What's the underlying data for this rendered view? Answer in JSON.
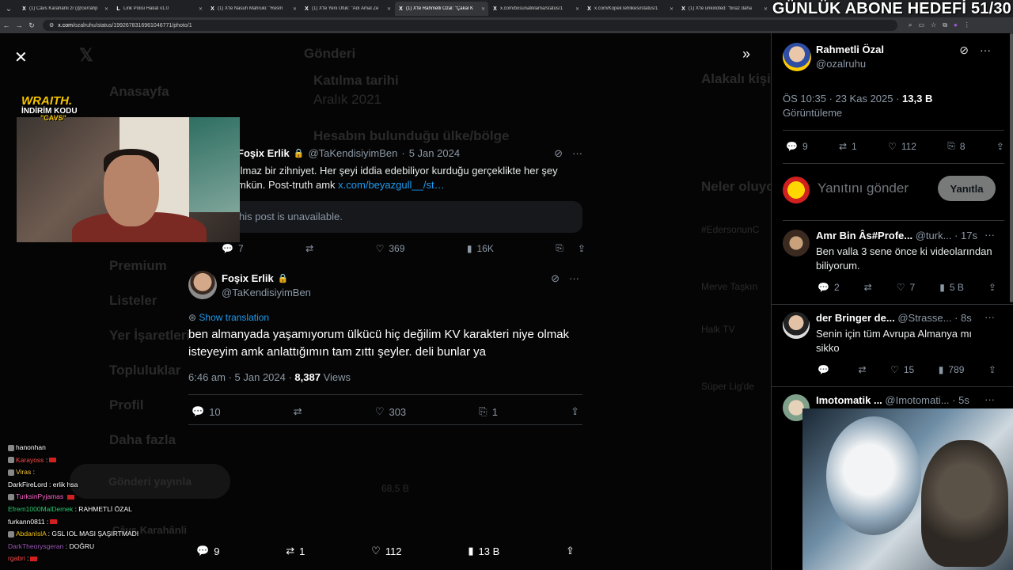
{
  "browser": {
    "tabs": [
      {
        "icon": "X",
        "title": "(1) Câvs Karahânli zr (@cerrahp",
        "active": false
      },
      {
        "icon": "L",
        "title": "Link Polisi Hakat v1.0",
        "active": false
      },
      {
        "icon": "X",
        "title": "(1) X'te Nasuh Mahruki: \"Resm",
        "active": false
      },
      {
        "icon": "X",
        "title": "(1) X'te Yeni Ufuk: \"Adı Amal Ze",
        "active": false
      },
      {
        "icon": "X",
        "title": "(1) X'te Rahmetli Özal: \"Çakal K",
        "active": true
      },
      {
        "icon": "X",
        "title": "x.com/bosunatiklama/status/1",
        "active": false
      },
      {
        "icon": "X",
        "title": "x.com/KopekTehlikesi/status/1",
        "active": false
      },
      {
        "icon": "X",
        "title": "(1) X'te unkindled: \"biraz daha",
        "active": false
      }
    ],
    "url_host": "x.com",
    "url_path": "/ozalruhu/status/1992678316961046771/photo/1"
  },
  "overlay": {
    "goal": "GÜNLÜK ABONE HEDEFİ 51/30",
    "sponsor_brand": "WRAITH.",
    "sponsor_line": "İNDİRİM KODU",
    "sponsor_code": "\"CAVS\""
  },
  "background_nav": {
    "items": [
      "Anasayfa",
      "Premium",
      "Listeler",
      "Yer İşaretleri",
      "Topluluklar",
      "Profil",
      "Daha fazla"
    ],
    "post_button": "Gönderi yayınla",
    "profile_name": "Câvs Karahânli",
    "header": "Gönderi",
    "join_title": "Katılma tarihi",
    "join_value": "Aralık 2021",
    "country_title": "Hesabın bulunduğu ülke/bölge",
    "related": "Alakalı kişi",
    "trending": "Neler oluyor",
    "trend_items": [
      "#EdersonunC",
      "Merve Taşkın",
      "Halk TV",
      "Süper Lig'de"
    ],
    "views_ghost": "68,5 B"
  },
  "quoted_tweet": {
    "name": "Foşix Erlik",
    "handle": "@TaKendisiyimBen",
    "date": "5 Jan 2024",
    "text": "ılmaz bir zihniyet. Her şeyi iddia edebiliyor kurduğu gerçeklikte her şey mkün. Post-truth amk",
    "link": "x.com/beyazgull__/st…",
    "unavailable": "his post is unavailable.",
    "replies": "7",
    "likes": "369",
    "views": "16K"
  },
  "main_tweet": {
    "name": "Foşix Erlik",
    "handle": "@TaKendisiyimBen",
    "translate": "Show translation",
    "text": "ben almanyada yaşamıyorum ülkücü hiç değilim KV karakteri niye olmak isteyeyim amk anlattığımın tam zıttı şeyler. deli bunlar ya",
    "time": "6:46 am · 5 Jan 2024 · ",
    "views_count": "8,387",
    "views_label": " Views",
    "replies": "10",
    "likes": "303",
    "bookmarks": "1"
  },
  "photo_bottom_bar": {
    "replies": "9",
    "reposts": "1",
    "likes": "112",
    "views": "13 B"
  },
  "panel": {
    "author_name": "Rahmetli Özal",
    "author_handle": "@ozalruhu",
    "timestamp": "ÖS 10:35 · 23 Kas 2025 · ",
    "views_count": "13,3 B",
    "views_label": "Görüntüleme",
    "replies": "9",
    "reposts": "1",
    "likes": "112",
    "bookmarks": "8",
    "reply_placeholder": "Yanıtını gönder",
    "reply_button": "Yanıtla",
    "replies_list": [
      {
        "name": "Amr Bin Âs#Profe...",
        "handle": "@turk...",
        "time": "· 17s",
        "text": "Ben valla 3 sene önce ki videolarından biliyorum.",
        "replies": "2",
        "likes": "7",
        "views": "5 B"
      },
      {
        "name": "der Bringer de...",
        "handle": "@Strasse...",
        "time": "· 8s",
        "text": "Senin için tüm Avrupa Almanya mı sikko",
        "replies": "",
        "likes": "15",
        "views": "789"
      },
      {
        "name": "Imotomatik ...",
        "handle": "@Imotomati...",
        "time": "· 5s",
        "text": "",
        "replies": "",
        "likes": "",
        "views": ""
      }
    ]
  },
  "chat": [
    {
      "user": "hanonhan",
      "color": "#ffffff",
      "msg": ""
    },
    {
      "user": "Karayoss",
      "color": "#ff4d4d",
      "msg": ":"
    },
    {
      "user": "Viras",
      "color": "#f5c542",
      "msg": ":"
    },
    {
      "user": "DarkFireLord",
      "color": "#ffffff",
      "msg": ": erlik hsa"
    },
    {
      "user": "TurksinPyjamas",
      "color": "#ff66cc",
      "msg": ""
    },
    {
      "user": "Efrem1000MalDemek",
      "color": "#2ecc71",
      "msg": ": RAHMETLİ ÖZAL"
    },
    {
      "user": "furkann0811",
      "color": "#ffffff",
      "msg": ":"
    },
    {
      "user": "AbdanIslA",
      "color": "#f1c40f",
      "msg": ": GSL IOL MASI ŞAŞIRTMADI"
    },
    {
      "user": "DarkTheorysgeran",
      "color": "#9b59b6",
      "msg": ": DOĞRU"
    },
    {
      "user": "rgabri",
      "color": "#ff4d4d",
      "msg": ":"
    }
  ],
  "icons": {
    "close": "close-icon",
    "expand": "double-chevron-right-icon",
    "reply": "reply-icon",
    "repost": "repost-icon",
    "like": "heart-icon",
    "views": "views-icon",
    "bookmark": "bookmark-icon",
    "share": "share-icon",
    "grok": "grok-icon",
    "more": "more-icon",
    "verified": "lock-icon"
  },
  "colors": {
    "link": "#1d9bf0",
    "muted": "#8b98a5",
    "goal_text": "#ffffff",
    "sponsor_yellow": "#f6c400"
  }
}
